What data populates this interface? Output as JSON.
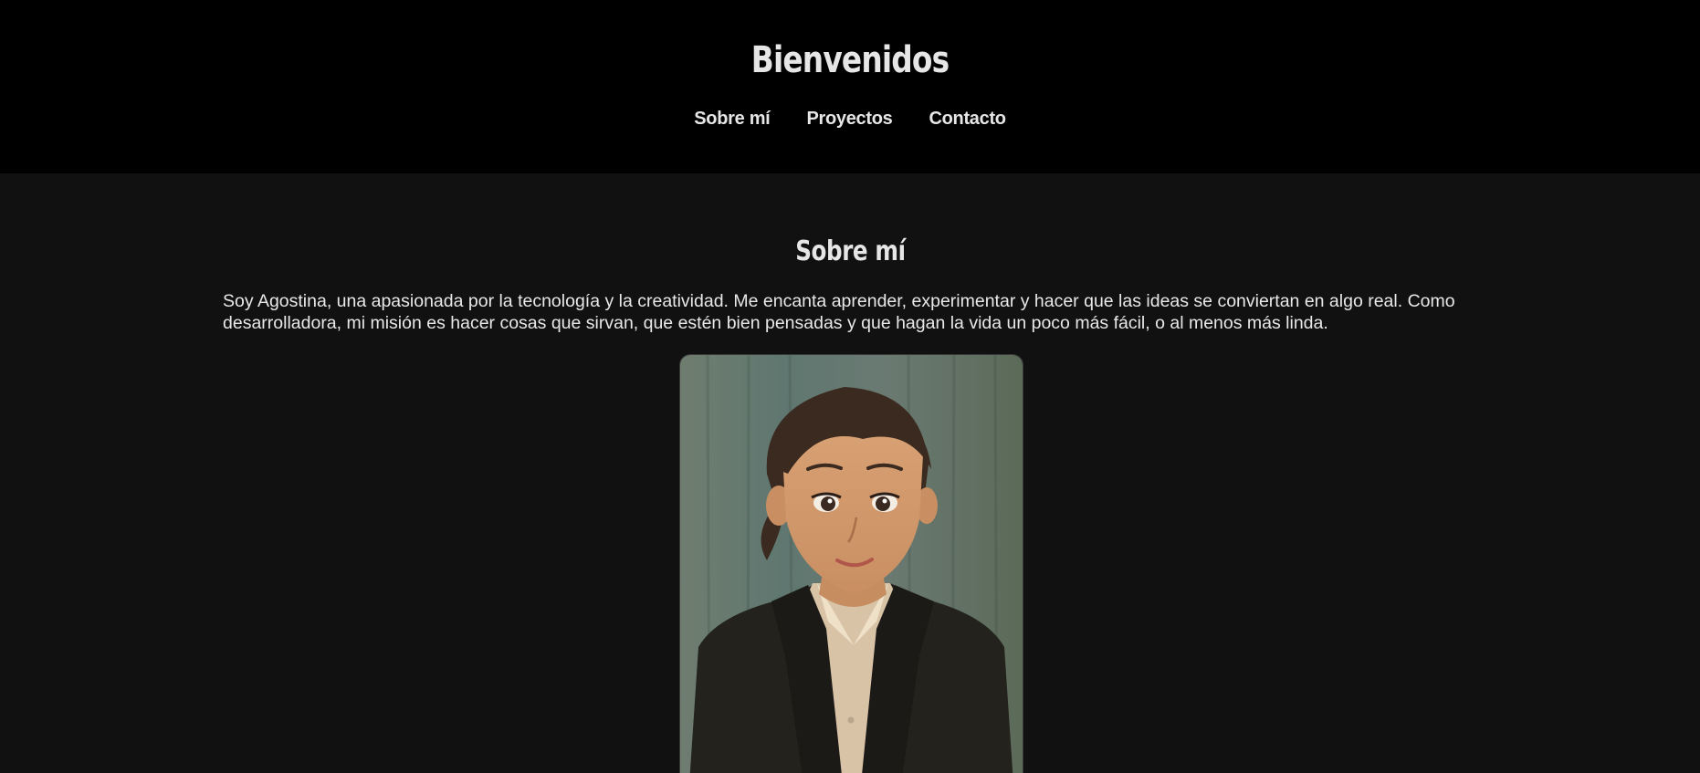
{
  "header": {
    "title": "Bienvenidos",
    "nav": [
      {
        "label": "Sobre mí"
      },
      {
        "label": "Proyectos"
      },
      {
        "label": "Contacto"
      }
    ]
  },
  "about": {
    "heading": "Sobre mí",
    "text": "Soy Agostina, una apasionada por la tecnología y la creatividad. Me encanta aprender, experimentar y hacer que las ideas se conviertan en algo real. Como desarrolladora, mi misión es hacer cosas que sirvan, que estén bien pensadas y que hagan la vida un poco más fácil, o al menos más linda.",
    "image_name": "illustrated-portrait"
  },
  "colors": {
    "header_bg": "#000000",
    "page_bg": "#111111",
    "text": "#e6e6e6"
  }
}
